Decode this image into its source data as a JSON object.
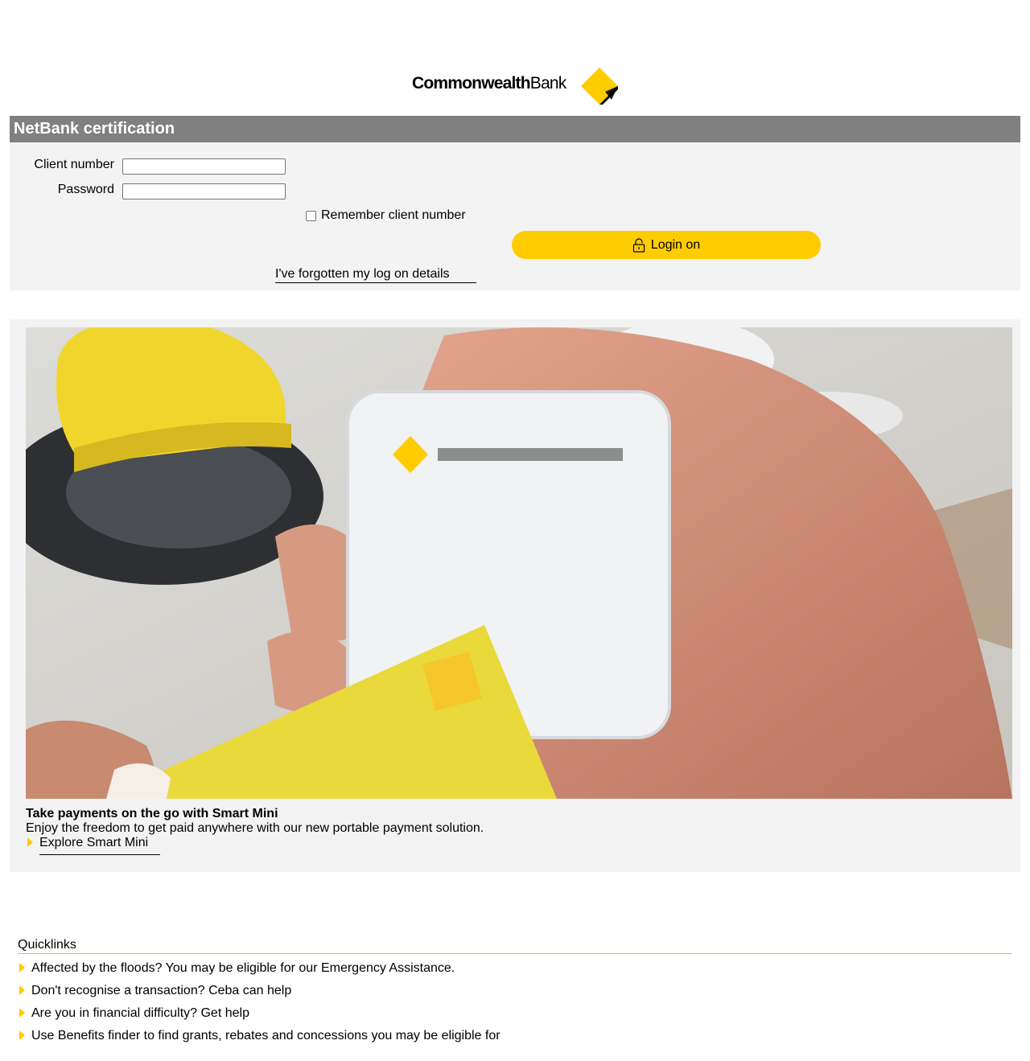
{
  "logo": {
    "text_bold": "Commonwealth",
    "text_regular": "Bank",
    "icon": "cba-diamond-logo",
    "colors": {
      "yellow": "#ffcc00",
      "black": "#000000"
    }
  },
  "login": {
    "header": "NetBank certification",
    "client_number_label": "Client number",
    "client_number_value": "",
    "password_label": "Password",
    "password_value": "",
    "remember_label": "Remember client number",
    "remember_checked": false,
    "login_button_label": "Login on",
    "login_button_icon": "lock-icon",
    "forgot_link": "I've forgotten my log on details"
  },
  "promo": {
    "image_desc_icon": "smart-mini-photo",
    "title": "Take payments on the go with Smart Mini",
    "description": "Enjoy the freedom to get paid anywhere with our new portable payment solution.",
    "link_label": "Explore Smart Mini"
  },
  "quicklinks": {
    "title": "Quicklinks",
    "items": [
      {
        "label": "Affected by the floods? You may be eligible for our Emergency Assistance."
      },
      {
        "label": "Don't recognise a transaction? Ceba can help"
      },
      {
        "label": "Are you in financial difficulty? Get help"
      },
      {
        "label": "Use Benefits finder to find grants, rebates and concessions you may be eligible for"
      }
    ]
  },
  "colors": {
    "panel_bg": "#f3f3f3",
    "header_bg": "#808080",
    "accent": "#ffcc00"
  }
}
